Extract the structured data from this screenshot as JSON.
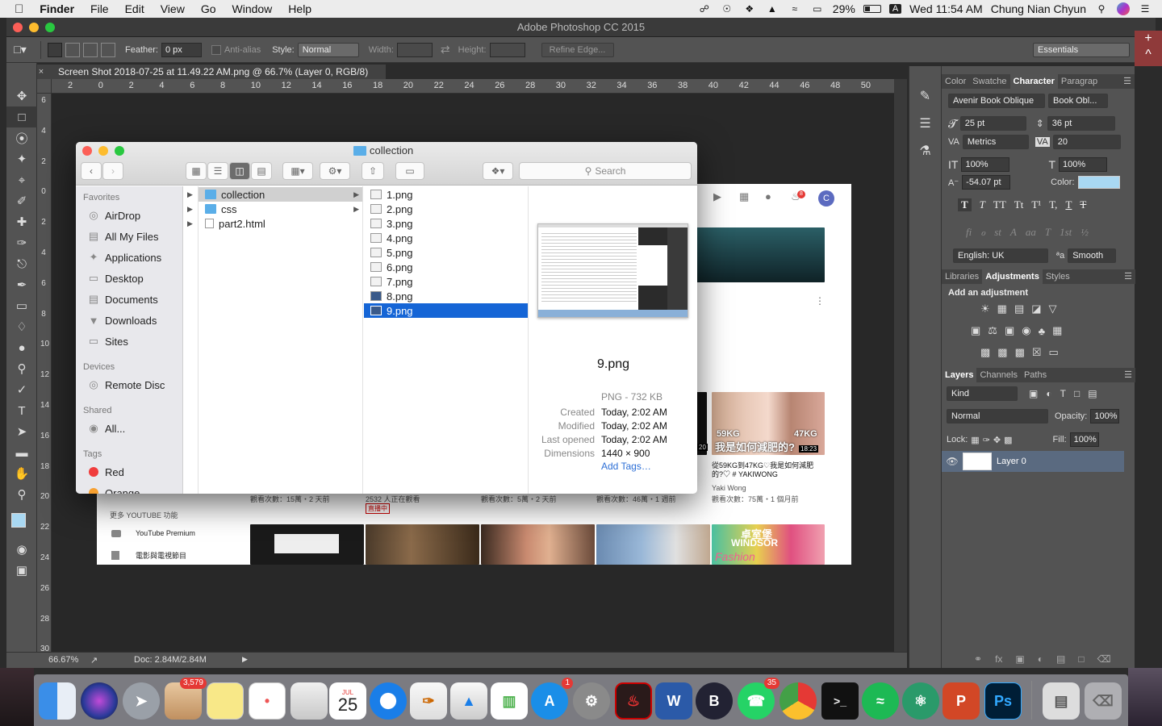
{
  "menubar": {
    "app_name": "Finder",
    "menus": [
      "File",
      "Edit",
      "View",
      "Go",
      "Window",
      "Help"
    ],
    "battery": "29%",
    "clock": "Wed 11:54 AM",
    "user": "Chung Nian Chyun",
    "input_source": "A"
  },
  "photoshop": {
    "title": "Adobe Photoshop CC 2015",
    "options": {
      "feather_label": "Feather:",
      "feather_value": "0 px",
      "antialias_label": "Anti-alias",
      "style_label": "Style:",
      "style_value": "Normal",
      "width_label": "Width:",
      "height_label": "Height:",
      "refine_edge": "Refine Edge...",
      "workspace": "Essentials"
    },
    "doc_tab": "Screen Shot 2018-07-25 at 11.49.22 AM.png @ 66.7% (Layer 0, RGB/8)",
    "ruler_top": [
      "2",
      "0",
      "2",
      "4",
      "6",
      "8",
      "10",
      "12",
      "14",
      "16",
      "18",
      "20",
      "22",
      "24",
      "26",
      "28",
      "30",
      "32",
      "34",
      "36",
      "38",
      "40",
      "42",
      "44",
      "46",
      "48",
      "50"
    ],
    "ruler_left": [
      "6",
      "4",
      "2",
      "0",
      "2",
      "4",
      "6",
      "8",
      "10",
      "12",
      "14",
      "16",
      "18",
      "20",
      "22",
      "24",
      "26",
      "28",
      "30"
    ],
    "status": {
      "zoom": "66.67%",
      "doc": "Doc: 2.84M/2.84M"
    },
    "canvas_content": {
      "sidebar_header": "更多 YOUTUBE 功能",
      "sidebar_items": [
        "YouTube Premium",
        "電影與電視節目"
      ],
      "views_1": "觀看次數：15萬・2 天前",
      "views_2": "2532 人正在觀看",
      "live_badge": "直播中",
      "views_3": "觀看次數：5萬・2 天前",
      "views_4": "觀看次數：46萬・1 週前",
      "views_5": "觀看次數：75萬・1 個月前",
      "video_title": "從59KG到47KG♡我是如何減肥的?♡ # YAKIWONG",
      "channel": "Yaki Wong",
      "overlay_1": "59KG",
      "overlay_2": "47KG",
      "overlay_3": "我是如何減肥的?",
      "duration": "18:23",
      "duration_2": "20",
      "notif_count": "8",
      "avatar": "C",
      "thumb_text": "卓室堡",
      "thumb_text_2": "WINDSOR",
      "thumb_text_3": "Fashion"
    },
    "character_panel": {
      "tabs": [
        "Color",
        "Swatche",
        "Character",
        "Paragrap"
      ],
      "font_family": "Avenir Book Oblique",
      "font_style": "Book Obl...",
      "size": "25 pt",
      "leading": "36 pt",
      "kerning": "Metrics",
      "tracking": "20",
      "vscale": "100%",
      "hscale": "100%",
      "baseline": "-54.07 pt",
      "color_label": "Color:",
      "text_color": "#a9d8f2",
      "style_buttons": [
        "T",
        "T",
        "TT",
        "Tt",
        "T¹",
        "T,",
        "T",
        "T"
      ],
      "opentype_buttons": [
        "fi",
        "ℴ",
        "st",
        "A",
        "aa",
        "T",
        "1st",
        "½"
      ],
      "language": "English: UK",
      "aa_label": "ªa",
      "antialias": "Smooth"
    },
    "adjustments_panel": {
      "tabs": [
        "Libraries",
        "Adjustments",
        "Styles"
      ],
      "heading": "Add an adjustment"
    },
    "layers_panel": {
      "tabs": [
        "Layers",
        "Channels",
        "Paths"
      ],
      "filter": "Kind",
      "blend_mode": "Normal",
      "opacity_label": "Opacity:",
      "opacity": "100%",
      "lock_label": "Lock:",
      "fill_label": "Fill:",
      "fill": "100%",
      "layer_name": "Layer 0"
    }
  },
  "finder": {
    "title": "collection",
    "search_placeholder": "Search",
    "sidebar": {
      "favorites_header": "Favorites",
      "favorites": [
        "AirDrop",
        "All My Files",
        "Applications",
        "Desktop",
        "Documents",
        "Downloads",
        "Sites"
      ],
      "devices_header": "Devices",
      "devices": [
        "Remote Disc"
      ],
      "shared_header": "Shared",
      "shared": [
        "All..."
      ],
      "tags_header": "Tags",
      "tags": [
        "Red",
        "Orange"
      ]
    },
    "column1": [
      "collection",
      "css",
      "part2.html"
    ],
    "column2": [
      "1.png",
      "2.png",
      "3.png",
      "4.png",
      "5.png",
      "6.png",
      "7.png",
      "8.png",
      "9.png"
    ],
    "preview": {
      "name": "9.png",
      "kind": "PNG - 732 KB",
      "labels": [
        "Created",
        "Modified",
        "Last opened",
        "Dimensions"
      ],
      "values": [
        "Today, 2:02 AM",
        "Today, 2:02 AM",
        "Today, 2:02 AM",
        "1440 × 900"
      ],
      "add_tags": "Add Tags…"
    }
  },
  "dock": {
    "mail_badge": "3,579",
    "calendar_month": "JUL",
    "calendar_day": "25",
    "appstore_badge": "1",
    "whatsapp_badge": "35",
    "word_label": "W",
    "ppt_label": "P",
    "ps_label": "Ps",
    "b_label": "B"
  }
}
